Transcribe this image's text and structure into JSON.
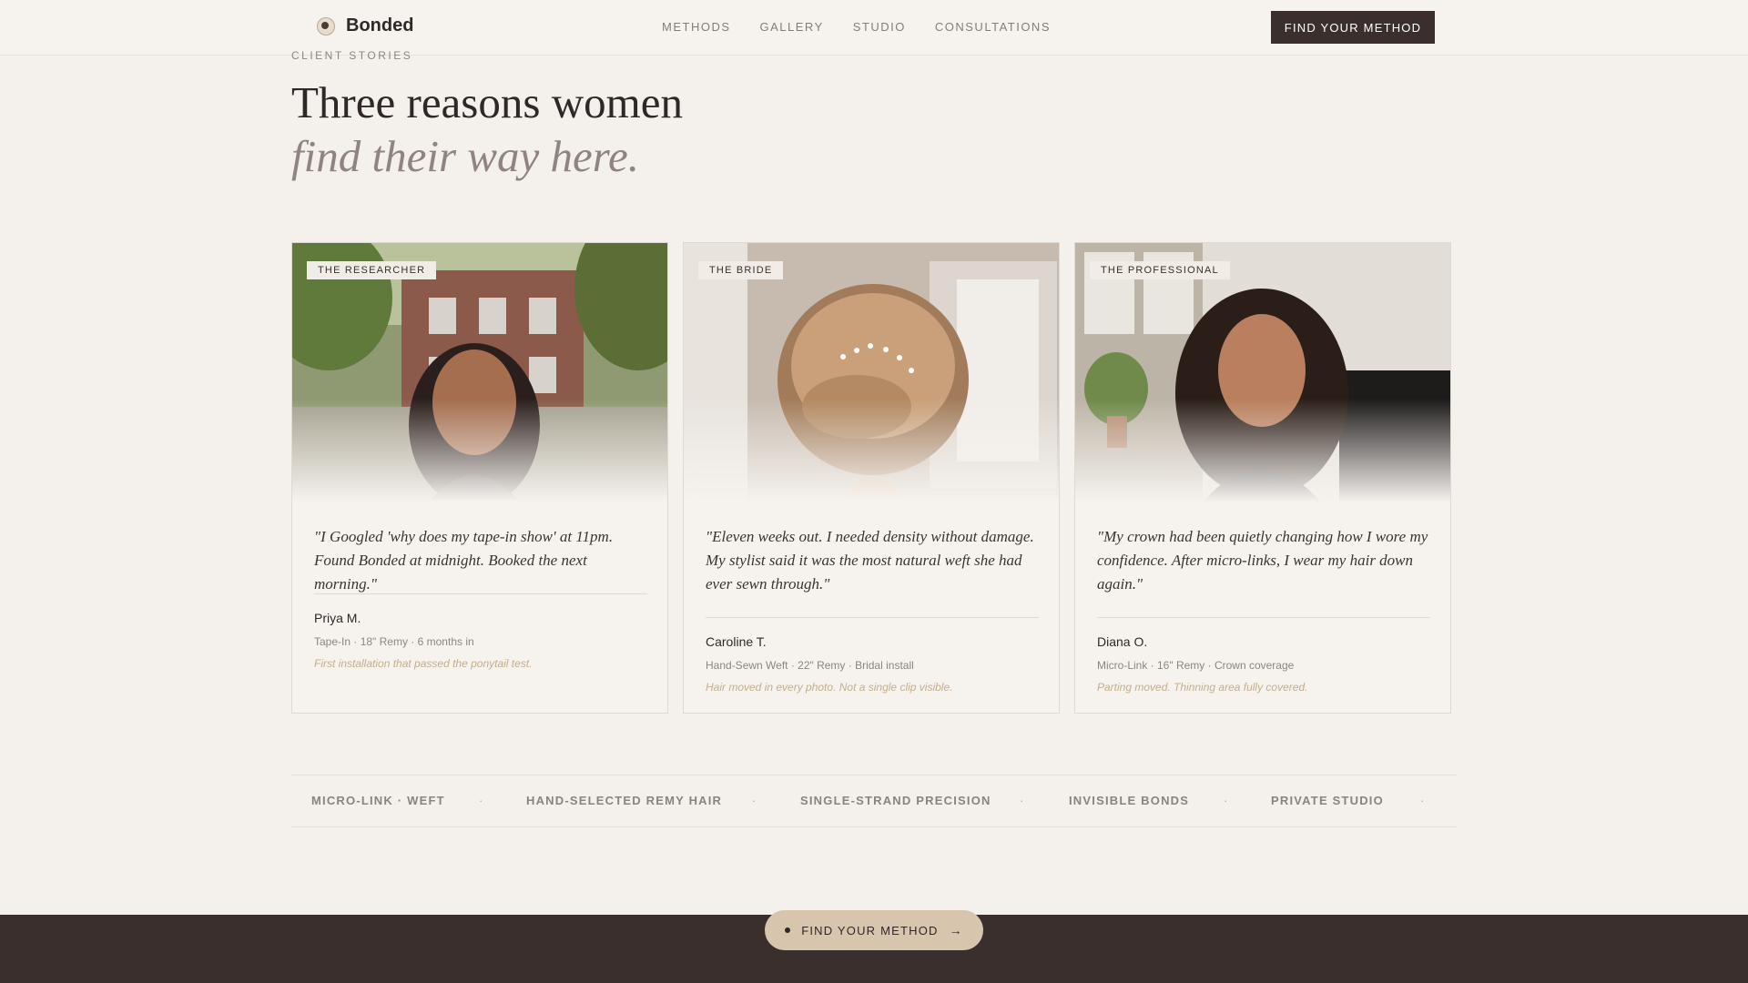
{
  "header": {
    "brand": "Bonded",
    "nav": [
      "METHODS",
      "GALLERY",
      "STUDIO",
      "CONSULTATIONS"
    ],
    "cta": "FIND YOUR METHOD"
  },
  "section": {
    "eyebrow": "CLIENT STORIES",
    "title_line1": "Three reasons women",
    "title_line2": "find their way here."
  },
  "cards": [
    {
      "tag": "THE RESEARCHER",
      "quote": "\"I Googled 'why does my tape-in show' at 11pm. Found Bonded at midnight. Booked the next morning.\"",
      "name": "Priya M.",
      "meta": "Tape-In · 18\" Remy · 6 months in",
      "note": "First installation that passed the ponytail test."
    },
    {
      "tag": "THE BRIDE",
      "quote": "\"Eleven weeks out. I needed density without damage. My stylist said it was the most natural weft she had ever sewn through.\"",
      "name": "Caroline T.",
      "meta": "Hand-Sewn Weft · 22\" Remy · Bridal install",
      "note": "Hair moved in every photo. Not a single clip visible."
    },
    {
      "tag": "THE PROFESSIONAL",
      "quote": "\"My crown had been quietly changing how I wore my confidence. After micro-links, I wear my hair down again.\"",
      "name": "Diana O.",
      "meta": "Micro-Link · 16\" Remy · Crown coverage",
      "note": "Parting moved. Thinning area fully covered."
    }
  ],
  "marquee": [
    "MICRO-LINK · WEFT",
    "HAND-SELECTED REMY HAIR",
    "SINGLE-STRAND PRECISION",
    "INVISIBLE BONDS",
    "PRIVATE STUDIO"
  ],
  "floating_cta": "FIND YOUR METHOD"
}
